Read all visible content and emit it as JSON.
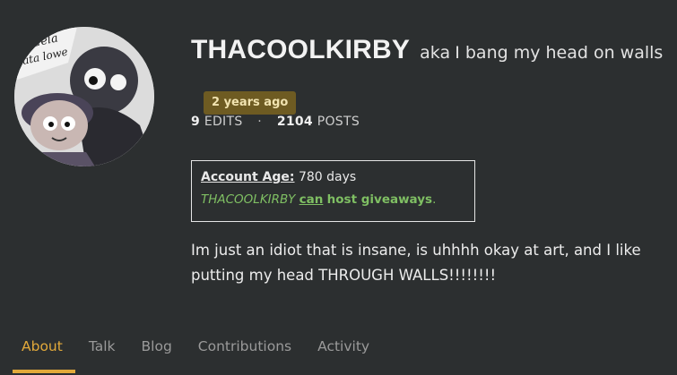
{
  "profile": {
    "username": "THACOOLKIRBY",
    "aka_prefix": "aka",
    "aka_text": "I bang my head on walls",
    "joined_badge": "2 years ago",
    "edits_count": "9",
    "edits_label": "EDITS",
    "posts_count": "2104",
    "posts_label": "POSTS",
    "avatar_icon": "avatar-image"
  },
  "infobox": {
    "account_age_label": "Account Age:",
    "account_age_value": "780 days",
    "giveaway_user": "THACOOLKIRBY",
    "giveaway_can": "can",
    "giveaway_rest": "host giveaways",
    "giveaway_period": "."
  },
  "bio": "Im just an idiot that is insane, is uhhhh okay at art, and I like putting my head THROUGH WALLS!!!!!!!!",
  "tabs": [
    {
      "label": "About"
    },
    {
      "label": "Talk"
    },
    {
      "label": "Blog"
    },
    {
      "label": "Contributions"
    },
    {
      "label": "Activity"
    }
  ],
  "colors": {
    "background": "#2c2f30",
    "accent": "#e2a93a",
    "badge": "#6e5b22",
    "giveaway_green": "#7fbf63"
  }
}
